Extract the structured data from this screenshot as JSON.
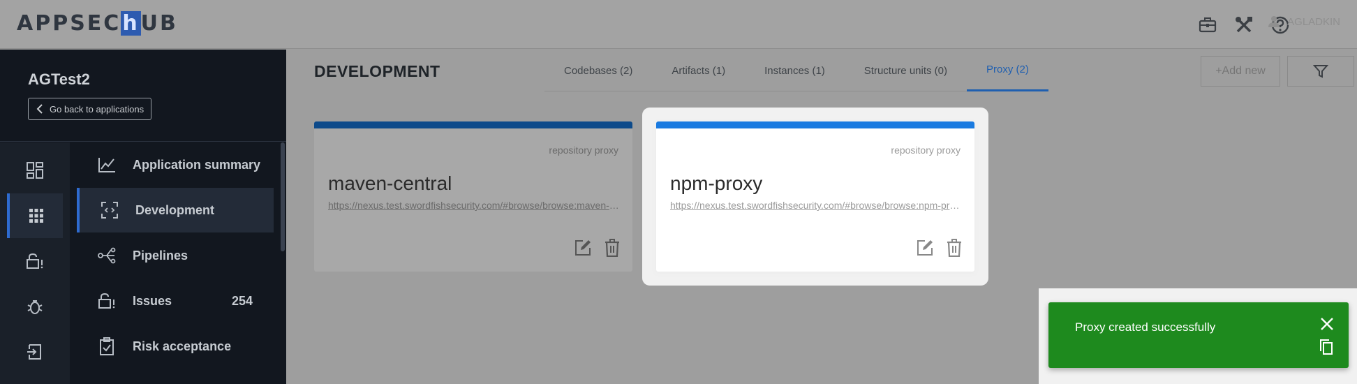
{
  "header": {
    "logo_prefix": "APPSEC",
    "logo_h": "h",
    "logo_suffix": "UB",
    "user_name": "AGLADKIN"
  },
  "sidebar": {
    "app_name": "AGTest2",
    "back_label": "Go back to applications",
    "nav": [
      {
        "label": "Application summary",
        "icon": "chart-line-icon"
      },
      {
        "label": "Development",
        "icon": "code-scan-icon"
      },
      {
        "label": "Pipelines",
        "icon": "pipeline-branch-icon"
      },
      {
        "label": "Issues",
        "icon": "lock-alert-icon",
        "count": "254"
      },
      {
        "label": "Risk acceptance",
        "icon": "clipboard-check-icon"
      }
    ]
  },
  "main": {
    "title": "DEVELOPMENT",
    "tabs": [
      {
        "label": "Codebases (2)"
      },
      {
        "label": "Artifacts (1)"
      },
      {
        "label": "Instances (1)"
      },
      {
        "label": "Structure units (0)"
      },
      {
        "label": "Proxy (2)"
      }
    ],
    "add_label": "+Add new",
    "cards": [
      {
        "type": "repository proxy",
        "name": "maven-central",
        "url": "https://nexus.test.swordfishsecurity.com/#browse/browse:maven-central"
      },
      {
        "type": "repository proxy",
        "name": "npm-proxy",
        "url": "https://nexus.test.swordfishsecurity.com/#browse/browse:npm-proxy"
      }
    ]
  },
  "toast": {
    "message": "Proxy created successfully",
    "color": "#1e8a1e"
  }
}
